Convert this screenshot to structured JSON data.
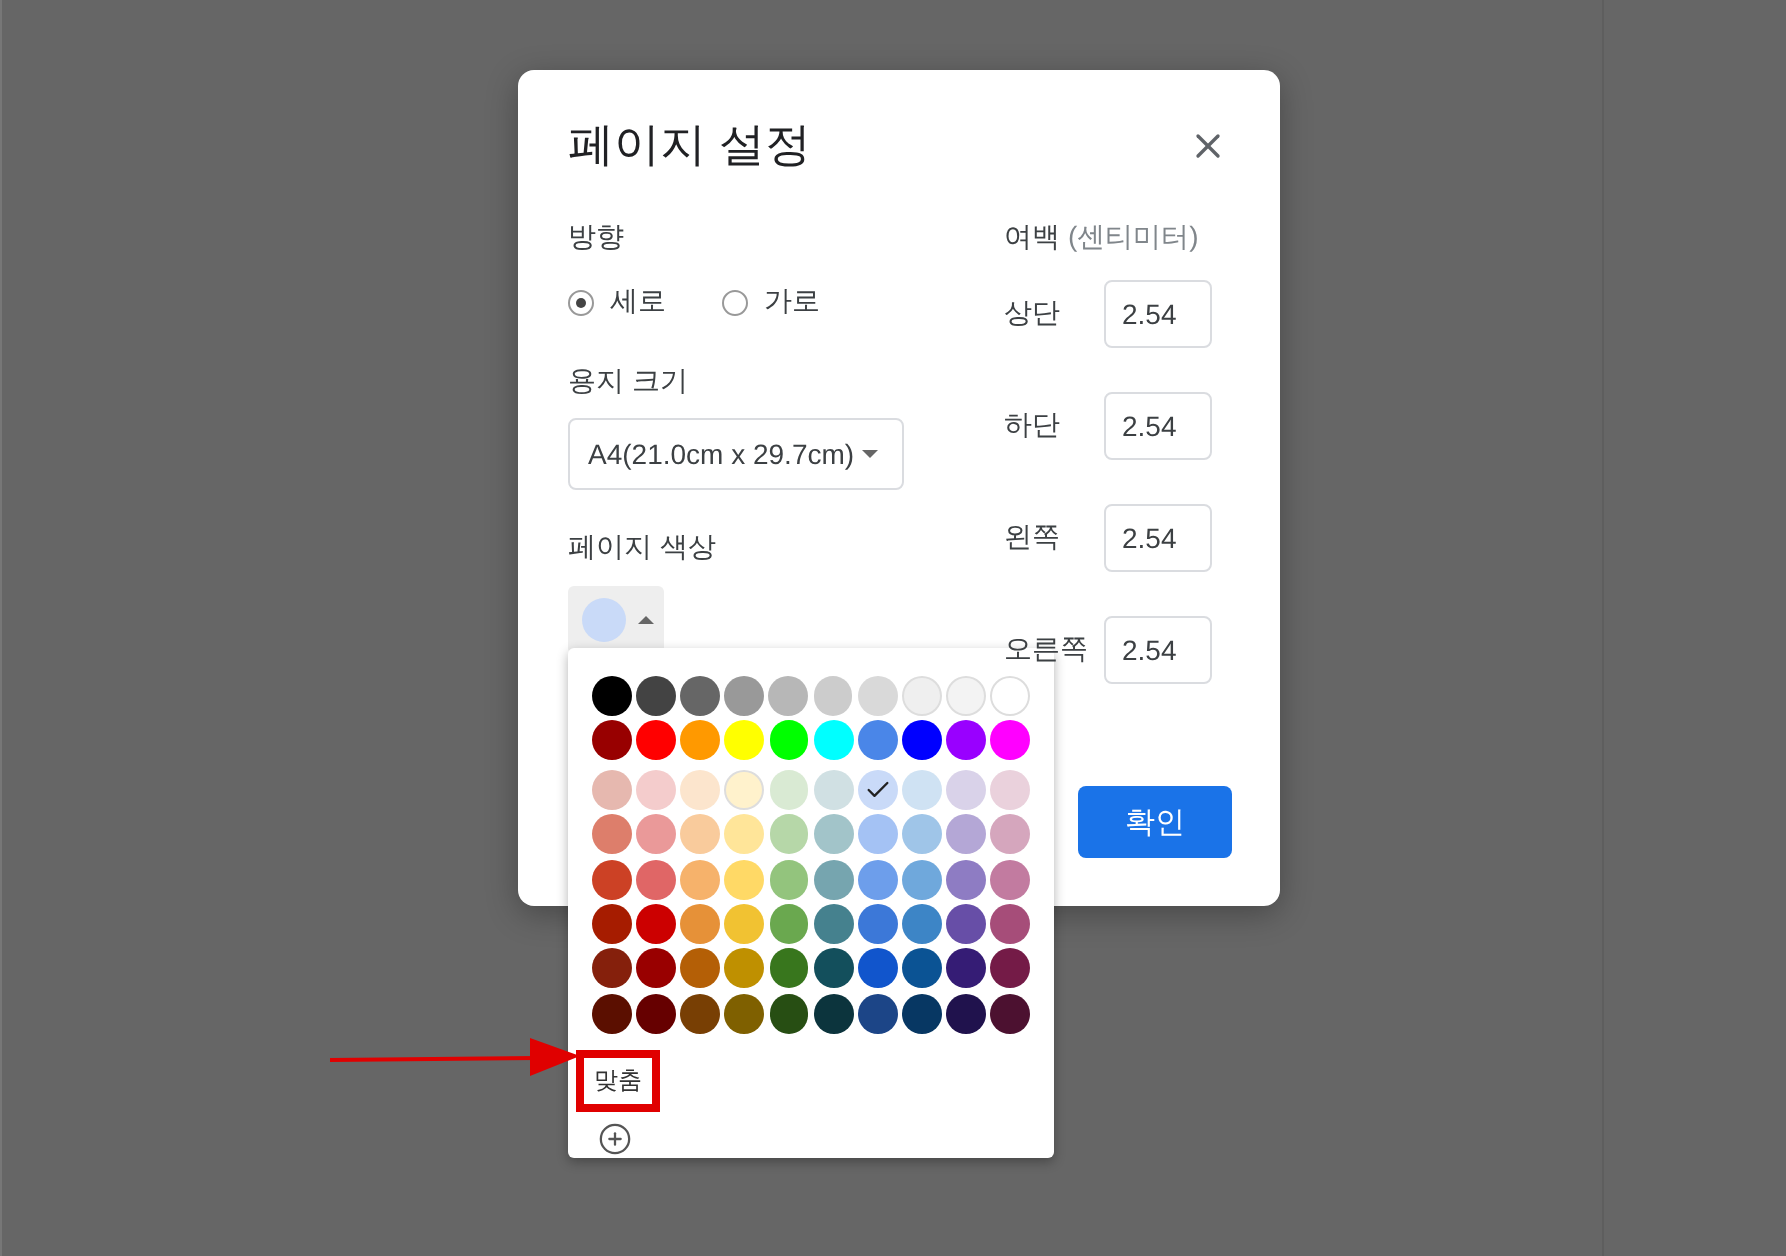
{
  "dialog": {
    "title": "페이지 설정",
    "orientation": {
      "label": "방향",
      "options": [
        {
          "label": "세로",
          "selected": true
        },
        {
          "label": "가로",
          "selected": false
        }
      ]
    },
    "paper_size": {
      "label": "용지 크기",
      "value": "A4(21.0cm x 29.7cm)"
    },
    "page_color": {
      "label": "페이지 색상",
      "color": "#c9daf8",
      "expanded": true
    },
    "margins": {
      "title": "여백",
      "unit": "(센티미터)",
      "fields": [
        {
          "label": "상단",
          "value": "2.54"
        },
        {
          "label": "하단",
          "value": "2.54"
        },
        {
          "label": "왼쪽",
          "value": "2.54"
        },
        {
          "label": "오른쪽",
          "value": "2.54"
        }
      ]
    },
    "ok_button": "확인"
  },
  "palette": {
    "rows": [
      [
        {
          "color": "#000000",
          "selected": false
        },
        {
          "color": "#434343",
          "selected": false
        },
        {
          "color": "#666666",
          "selected": false
        },
        {
          "color": "#999999",
          "selected": false
        },
        {
          "color": "#b7b7b7",
          "selected": false
        },
        {
          "color": "#cccccc",
          "selected": false
        },
        {
          "color": "#d9d9d9",
          "selected": false
        },
        {
          "color": "#efefef",
          "selected": false
        },
        {
          "color": "#f3f3f3",
          "selected": false
        },
        {
          "color": "#ffffff",
          "selected": false
        }
      ],
      [
        {
          "color": "#980000",
          "selected": false
        },
        {
          "color": "#ff0000",
          "selected": false
        },
        {
          "color": "#ff9900",
          "selected": false
        },
        {
          "color": "#ffff00",
          "selected": false
        },
        {
          "color": "#00ff00",
          "selected": false
        },
        {
          "color": "#00ffff",
          "selected": false
        },
        {
          "color": "#4a86e8",
          "selected": false
        },
        {
          "color": "#0000ff",
          "selected": false
        },
        {
          "color": "#9900ff",
          "selected": false
        },
        {
          "color": "#ff00ff",
          "selected": false
        }
      ],
      [
        {
          "color": "#e6b8af",
          "selected": false
        },
        {
          "color": "#f4cccc",
          "selected": false
        },
        {
          "color": "#fce5cd",
          "selected": false
        },
        {
          "color": "#fff2cc",
          "selected": false
        },
        {
          "color": "#d9ead3",
          "selected": false
        },
        {
          "color": "#d0e0e3",
          "selected": false
        },
        {
          "color": "#c9daf8",
          "selected": true
        },
        {
          "color": "#cfe2f3",
          "selected": false
        },
        {
          "color": "#d9d2e9",
          "selected": false
        },
        {
          "color": "#ead1dc",
          "selected": false
        }
      ],
      [
        {
          "color": "#dd7e6b",
          "selected": false
        },
        {
          "color": "#ea9999",
          "selected": false
        },
        {
          "color": "#f9cb9c",
          "selected": false
        },
        {
          "color": "#ffe599",
          "selected": false
        },
        {
          "color": "#b6d7a8",
          "selected": false
        },
        {
          "color": "#a2c4c9",
          "selected": false
        },
        {
          "color": "#a4c2f4",
          "selected": false
        },
        {
          "color": "#9fc5e8",
          "selected": false
        },
        {
          "color": "#b4a7d6",
          "selected": false
        },
        {
          "color": "#d5a6bd",
          "selected": false
        }
      ],
      [
        {
          "color": "#cc4125",
          "selected": false
        },
        {
          "color": "#e06666",
          "selected": false
        },
        {
          "color": "#f6b26b",
          "selected": false
        },
        {
          "color": "#ffd966",
          "selected": false
        },
        {
          "color": "#93c47d",
          "selected": false
        },
        {
          "color": "#76a5af",
          "selected": false
        },
        {
          "color": "#6d9eeb",
          "selected": false
        },
        {
          "color": "#6fa8dc",
          "selected": false
        },
        {
          "color": "#8e7cc3",
          "selected": false
        },
        {
          "color": "#c27ba0",
          "selected": false
        }
      ],
      [
        {
          "color": "#a61c00",
          "selected": false
        },
        {
          "color": "#cc0000",
          "selected": false
        },
        {
          "color": "#e69138",
          "selected": false
        },
        {
          "color": "#f1c232",
          "selected": false
        },
        {
          "color": "#6aa84f",
          "selected": false
        },
        {
          "color": "#45818e",
          "selected": false
        },
        {
          "color": "#3c78d8",
          "selected": false
        },
        {
          "color": "#3d85c6",
          "selected": false
        },
        {
          "color": "#674ea7",
          "selected": false
        },
        {
          "color": "#a64d79",
          "selected": false
        }
      ],
      [
        {
          "color": "#85200c",
          "selected": false
        },
        {
          "color": "#990000",
          "selected": false
        },
        {
          "color": "#b45f06",
          "selected": false
        },
        {
          "color": "#bf9000",
          "selected": false
        },
        {
          "color": "#38761d",
          "selected": false
        },
        {
          "color": "#134f5c",
          "selected": false
        },
        {
          "color": "#1155cc",
          "selected": false
        },
        {
          "color": "#0b5394",
          "selected": false
        },
        {
          "color": "#351c75",
          "selected": false
        },
        {
          "color": "#741b47",
          "selected": false
        }
      ],
      [
        {
          "color": "#5b0f00",
          "selected": false
        },
        {
          "color": "#660000",
          "selected": false
        },
        {
          "color": "#783f04",
          "selected": false
        },
        {
          "color": "#7f6000",
          "selected": false
        },
        {
          "color": "#274e13",
          "selected": false
        },
        {
          "color": "#0c343d",
          "selected": false
        },
        {
          "color": "#1c4587",
          "selected": false
        },
        {
          "color": "#073763",
          "selected": false
        },
        {
          "color": "#20124d",
          "selected": false
        },
        {
          "color": "#4c1130",
          "selected": false
        }
      ]
    ],
    "custom_label": "맞춤"
  }
}
